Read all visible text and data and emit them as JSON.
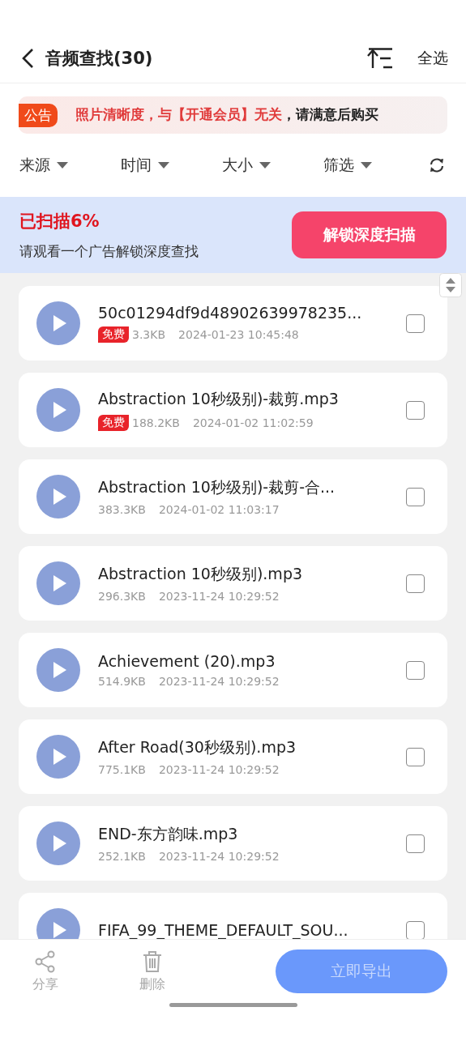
{
  "header": {
    "title": "音频查找(30)",
    "select_all": "全选"
  },
  "notice": {
    "badge": "公告",
    "highlight": "照片清晰度，与【开通会员】无关",
    "rest": "，请满意后购买"
  },
  "filters": [
    {
      "label": "来源"
    },
    {
      "label": "时间"
    },
    {
      "label": "大小"
    },
    {
      "label": "筛选"
    }
  ],
  "scan": {
    "status": "已扫描6%",
    "hint": "请观看一个广告解锁深度查找",
    "button": "解锁深度扫描"
  },
  "files": [
    {
      "name": "50c01294df9d48902639978235...",
      "free": true,
      "free_label": "免费",
      "size": "3.3KB",
      "time": "2024-01-23 10:45:48",
      "checked": false
    },
    {
      "name": "Abstraction 10秒级别)-裁剪.mp3",
      "free": true,
      "free_label": "免费",
      "size": "188.2KB",
      "time": "2024-01-02 11:02:59",
      "checked": false
    },
    {
      "name": "Abstraction 10秒级别)-裁剪-合...",
      "free": false,
      "size": "383.3KB",
      "time": "2024-01-02 11:03:17",
      "checked": false
    },
    {
      "name": "Abstraction 10秒级别).mp3",
      "free": false,
      "size": "296.3KB",
      "time": "2023-11-24 10:29:52",
      "checked": false
    },
    {
      "name": "Achievement (20).mp3",
      "free": false,
      "size": "514.9KB",
      "time": "2023-11-24 10:29:52",
      "checked": false
    },
    {
      "name": "After Road(30秒级别).mp3",
      "free": false,
      "size": "775.1KB",
      "time": "2023-11-24 10:29:52",
      "checked": false
    },
    {
      "name": "END-东方韵味.mp3",
      "free": false,
      "size": "252.1KB",
      "time": "2023-11-24 10:29:52",
      "checked": false
    },
    {
      "name": "FIFA_99_THEME_DEFAULT_SOU...",
      "free": false,
      "checked": false
    }
  ],
  "actions": [
    {
      "kind": "share",
      "label": "分享",
      "disabled": true
    },
    {
      "kind": "delete",
      "label": "删除",
      "disabled": true
    }
  ],
  "export_button": {
    "label": "立即导出",
    "disabled": true
  }
}
